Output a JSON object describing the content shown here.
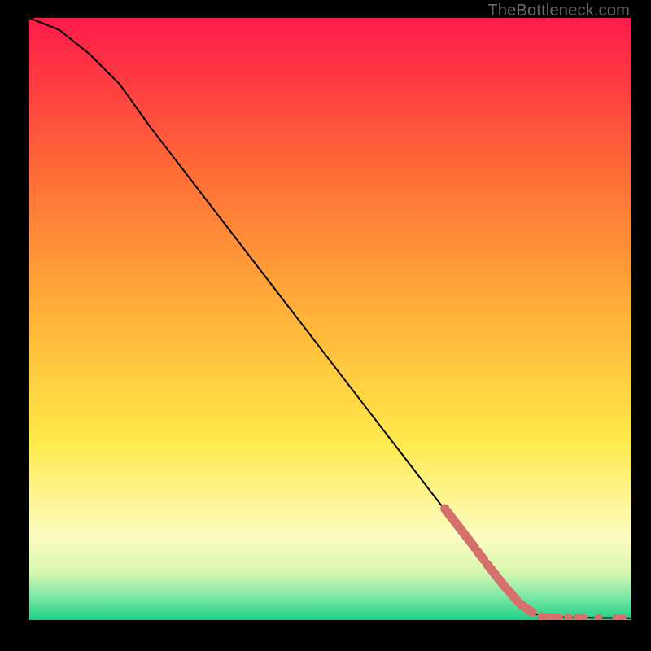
{
  "attribution": "TheBottleneck.com",
  "chart_data": {
    "type": "line",
    "title": "",
    "xlabel": "",
    "ylabel": "",
    "xlim": [
      0,
      100
    ],
    "ylim": [
      0,
      100
    ],
    "gradient_stops": [
      {
        "offset": 0,
        "color": "#ff1a4b"
      },
      {
        "offset": 25,
        "color": "#ff6a36"
      },
      {
        "offset": 50,
        "color": "#ffb43a"
      },
      {
        "offset": 70,
        "color": "#ffe94a"
      },
      {
        "offset": 86,
        "color": "#fdfcc0"
      },
      {
        "offset": 92,
        "color": "#d8f7b0"
      },
      {
        "offset": 96,
        "color": "#7fe9a8"
      },
      {
        "offset": 100,
        "color": "#1ecf86"
      }
    ],
    "curve": [
      {
        "x": 0,
        "y": 100
      },
      {
        "x": 5,
        "y": 98
      },
      {
        "x": 10,
        "y": 94
      },
      {
        "x": 15,
        "y": 89
      },
      {
        "x": 20,
        "y": 82
      },
      {
        "x": 30,
        "y": 69
      },
      {
        "x": 40,
        "y": 56
      },
      {
        "x": 50,
        "y": 43
      },
      {
        "x": 60,
        "y": 30
      },
      {
        "x": 70,
        "y": 17
      },
      {
        "x": 78,
        "y": 6
      },
      {
        "x": 82,
        "y": 2
      },
      {
        "x": 85,
        "y": 0.6
      },
      {
        "x": 90,
        "y": 0.4
      },
      {
        "x": 100,
        "y": 0.3
      }
    ],
    "highlight_segments": [
      {
        "x0": 69,
        "y0": 18.5,
        "x1": 74,
        "y1": 12
      },
      {
        "x0": 74.5,
        "y0": 11.3,
        "x1": 75.5,
        "y1": 10
      },
      {
        "x0": 76,
        "y0": 9.3,
        "x1": 79,
        "y1": 5.5
      },
      {
        "x0": 79.5,
        "y0": 5,
        "x1": 81,
        "y1": 3.2
      },
      {
        "x0": 81.5,
        "y0": 2.7,
        "x1": 83.5,
        "y1": 1.3
      }
    ],
    "highlight_dots": [
      {
        "x": 85,
        "y": 0.6
      },
      {
        "x": 86,
        "y": 0.55
      },
      {
        "x": 87,
        "y": 0.5
      },
      {
        "x": 88,
        "y": 0.48
      },
      {
        "x": 89.5,
        "y": 0.45
      },
      {
        "x": 91,
        "y": 0.42
      },
      {
        "x": 92,
        "y": 0.4
      },
      {
        "x": 94.5,
        "y": 0.38
      },
      {
        "x": 97.5,
        "y": 0.33
      },
      {
        "x": 98.5,
        "y": 0.32
      }
    ],
    "highlight_color": "#d6706b",
    "curve_color": "#000000"
  }
}
